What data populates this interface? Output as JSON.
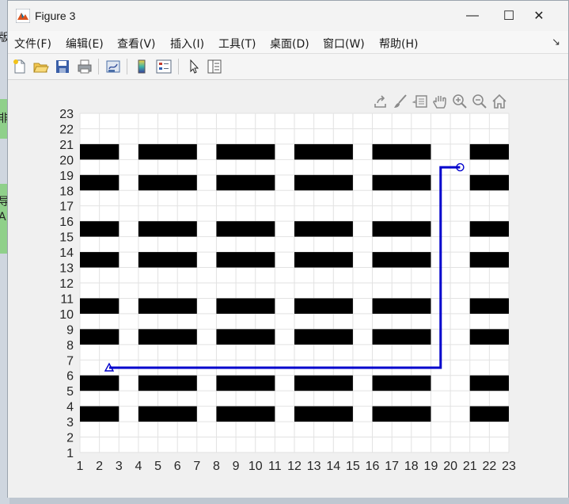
{
  "window": {
    "title": "Figure 3",
    "buttons": {
      "minimize": "—",
      "maximize": "☐",
      "close": "✕"
    }
  },
  "background": {
    "fragments": [
      "版",
      "非",
      "导",
      "A"
    ]
  },
  "menu": {
    "items": [
      "文件(F)",
      "编辑(E)",
      "查看(V)",
      "插入(I)",
      "工具(T)",
      "桌面(D)",
      "窗口(W)",
      "帮助(H)"
    ],
    "overflow": "↘"
  },
  "toolbar": {
    "buttons": [
      "new-figure-icon",
      "open-file-icon",
      "save-icon",
      "print-icon",
      "link-plot-icon",
      "colorbar-icon",
      "legend-icon",
      "pointer-icon",
      "property-inspector-icon"
    ]
  },
  "axes_toolbar": {
    "buttons": [
      "export-icon",
      "brush-icon",
      "data-tips-icon",
      "pan-icon",
      "zoom-in-icon",
      "zoom-out-icon",
      "home-icon"
    ]
  },
  "chart_data": {
    "type": "scatter",
    "title": "",
    "xlabel": "",
    "ylabel": "",
    "xlim": [
      1,
      23
    ],
    "ylim": [
      1,
      23
    ],
    "xticks": [
      1,
      2,
      3,
      4,
      5,
      6,
      7,
      8,
      9,
      10,
      11,
      12,
      13,
      14,
      15,
      16,
      17,
      18,
      19,
      20,
      21,
      22,
      23
    ],
    "yticks": [
      1,
      2,
      3,
      4,
      5,
      6,
      7,
      8,
      9,
      10,
      11,
      12,
      13,
      14,
      15,
      16,
      17,
      18,
      19,
      20,
      21,
      22,
      23
    ],
    "grid": true,
    "colors": {
      "obstacle": "#000000",
      "path": "#0000cc",
      "grid": "#e2e2e2",
      "axes_bg": "#ffffff"
    },
    "obstacles": {
      "x_ranges": [
        [
          1,
          3
        ],
        [
          4,
          7
        ],
        [
          8,
          11
        ],
        [
          12,
          15
        ],
        [
          16,
          19
        ],
        [
          21,
          23
        ]
      ],
      "y_ranges": [
        [
          3,
          4
        ],
        [
          5,
          6
        ],
        [
          8,
          9
        ],
        [
          10,
          11
        ],
        [
          13,
          14
        ],
        [
          15,
          16
        ],
        [
          18,
          19
        ],
        [
          20,
          21
        ]
      ]
    },
    "path": {
      "x": [
        2.5,
        19.5,
        19.5,
        20.5
      ],
      "y": [
        6.5,
        6.5,
        19.5,
        19.5
      ]
    },
    "start": {
      "x": 2.5,
      "y": 6.5,
      "marker": "triangle"
    },
    "goal": {
      "x": 20.5,
      "y": 19.5,
      "marker": "circle"
    }
  }
}
